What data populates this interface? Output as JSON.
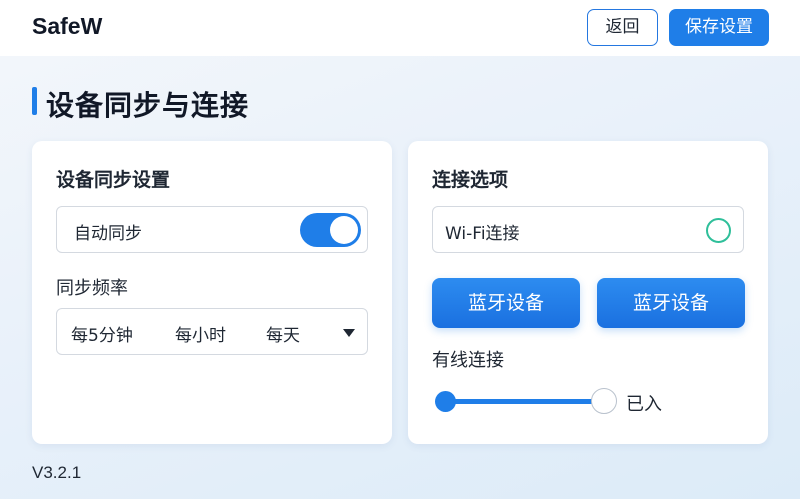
{
  "header": {
    "brand": "SafeW",
    "back_label": "返回",
    "save_label": "保存设置"
  },
  "page": {
    "title": "设备同步与连接"
  },
  "sync": {
    "title": "设备同步设置",
    "auto_sync_label": "自动同步",
    "auto_sync_on": true,
    "frequency_label": "同步频率",
    "frequency_options": [
      "每5分钟",
      "每小时",
      "每天"
    ]
  },
  "connection": {
    "title": "连接选项",
    "wifi_label": "Wi-Fi连接",
    "bluetooth_buttons": [
      "蓝牙设备",
      "蓝牙设备"
    ],
    "wired_label": "有线连接",
    "wired_status": "已入"
  },
  "footer": {
    "version": "V3.2.1"
  },
  "colors": {
    "accent": "#1f7ee8",
    "radio_ring": "#2fbf9a"
  }
}
